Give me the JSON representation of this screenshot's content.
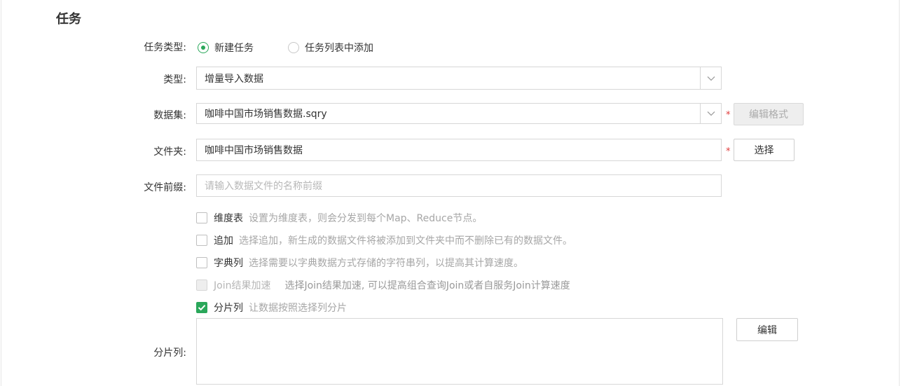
{
  "section_title": "任务",
  "task_type": {
    "label": "任务类型:",
    "options": [
      {
        "label": "新建任务",
        "selected": true
      },
      {
        "label": "任务列表中添加",
        "selected": false
      }
    ]
  },
  "type": {
    "label": "类型:",
    "value": "增量导入数据"
  },
  "dataset": {
    "label": "数据集:",
    "value": "咖啡中国市场销售数据.sqry",
    "required_mark": "*",
    "edit_format_button": "编辑格式"
  },
  "folder": {
    "label": "文件夹:",
    "value": "咖啡中国市场销售数据",
    "required_mark": "*",
    "select_button": "选择"
  },
  "file_prefix": {
    "label": "文件前缀:",
    "placeholder": "请输入数据文件的名称前缀"
  },
  "options": [
    {
      "name": "维度表",
      "desc": "设置为维度表，则会分发到每个Map、Reduce节点。",
      "checked": false,
      "disabled": false
    },
    {
      "name": "追加",
      "desc": "选择追加，新生成的数据文件将被添加到文件夹中而不删除已有的数据文件。",
      "checked": false,
      "disabled": false
    },
    {
      "name": "字典列",
      "desc": "选择需要以字典数据方式存储的字符串列，以提高其计算速度。",
      "checked": false,
      "disabled": false
    },
    {
      "name": "Join结果加速",
      "desc": "选择Join结果加速, 可以提高组合查询Join或者自服务Join计算速度",
      "checked": false,
      "disabled": true
    },
    {
      "name": "分片列",
      "desc": "让数据按照选择列分片",
      "checked": true,
      "disabled": false
    }
  ],
  "shard_columns": {
    "label": "分片列:",
    "edit_button": "编辑"
  },
  "colors": {
    "accent": "#2aa75a",
    "required": "#e03c3c"
  }
}
